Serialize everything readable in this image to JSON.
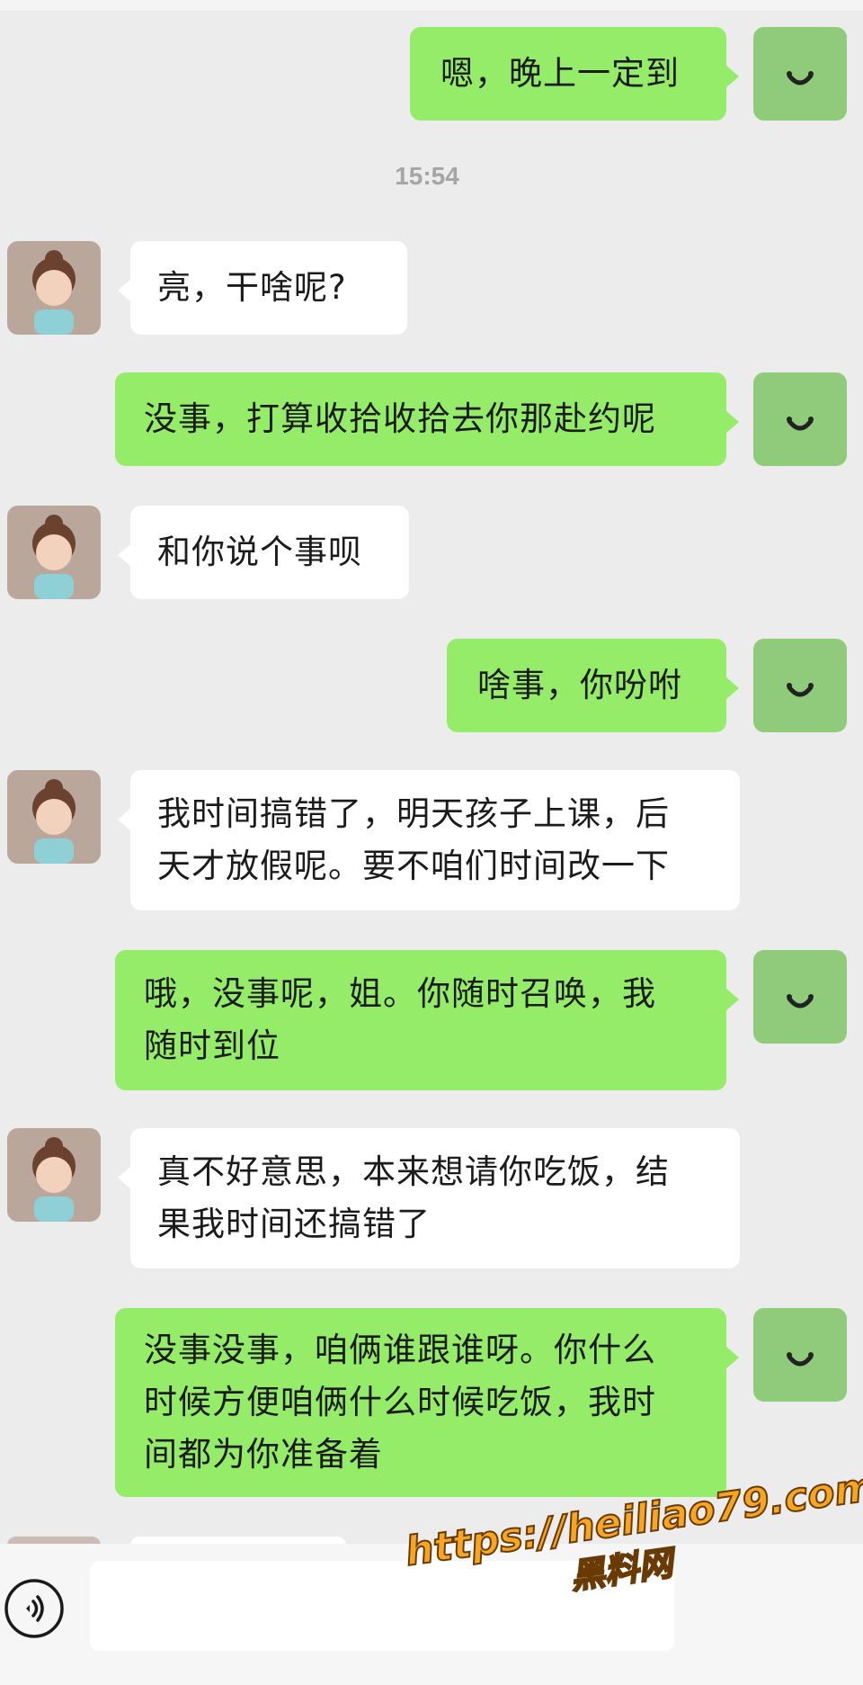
{
  "timestamp": "15:54",
  "messages": [
    {
      "from": "me",
      "text": "嗯，晚上一定到"
    },
    {
      "from": "them",
      "text": "亮，干啥呢?"
    },
    {
      "from": "me",
      "text": "没事，打算收拾收拾去你那赴约呢"
    },
    {
      "from": "them",
      "text": "和你说个事呗"
    },
    {
      "from": "me",
      "text": "啥事，你吩咐"
    },
    {
      "from": "them",
      "text": "我时间搞错了，明天孩子上课，后\n天才放假呢。要不咱们时间改一下"
    },
    {
      "from": "me",
      "text": "哦，没事呢，姐。你随时召唤，我\n随时到位"
    },
    {
      "from": "them",
      "text": "真不好意思，本来想请你吃饭，结\n果我时间还搞错了"
    },
    {
      "from": "me",
      "text": "没事没事，咱俩谁跟谁呀。你什么\n时候方便咱俩什么时候吃饭，我时\n间都为你准备着"
    }
  ],
  "input": {
    "value": "",
    "placeholder": ""
  },
  "watermark": {
    "url": "https://heiliao79.com",
    "name": "黑料网"
  },
  "colors": {
    "me_bubble": "#95ec69",
    "them_bubble": "#ffffff",
    "background": "#ececec"
  },
  "icons": {
    "voice": "voice-icon",
    "me_avatar": "smile-face-avatar",
    "them_avatar": "cartoon-girl-avatar"
  }
}
